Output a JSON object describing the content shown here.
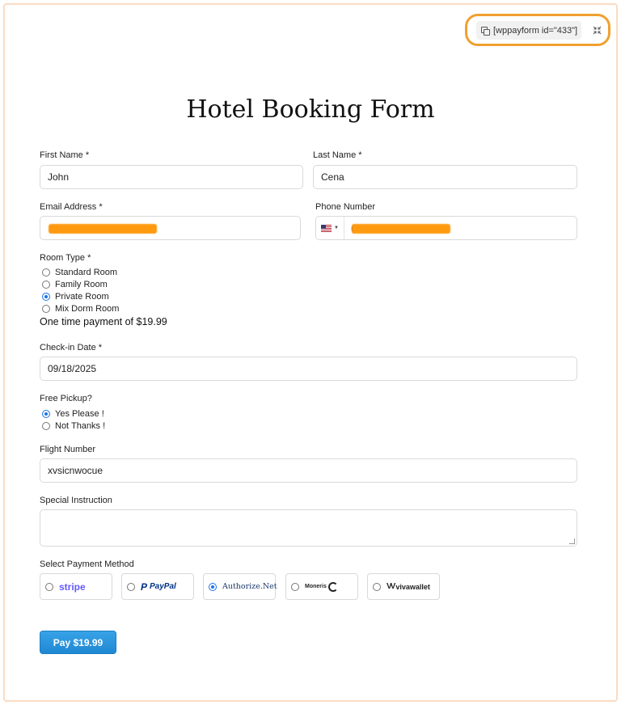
{
  "shortcode": {
    "text": "[wppayform id=\"433\"]"
  },
  "form": {
    "title": "Hotel Booking Form",
    "first_name": {
      "label": "First Name *",
      "value": "John"
    },
    "last_name": {
      "label": "Last Name *",
      "value": "Cena"
    },
    "email": {
      "label": "Email Address *"
    },
    "phone": {
      "label": "Phone Number",
      "prefix": "("
    },
    "room_type": {
      "label": "Room Type *",
      "options": [
        "Standard Room",
        "Family Room",
        "Private Room",
        "Mix Dorm Room"
      ],
      "selected": "Private Room"
    },
    "payment_note": "One time payment of $19.99",
    "checkin": {
      "label": "Check-in Date *",
      "value": "09/18/2025"
    },
    "pickup": {
      "label": "Free Pickup?",
      "options": [
        "Yes Please !",
        "Not Thanks !"
      ],
      "selected": "Yes Please !"
    },
    "flight": {
      "label": "Flight Number",
      "value": "xvsicnwocue"
    },
    "special": {
      "label": "Special Instruction",
      "value": ""
    },
    "payment_method": {
      "label": "Select Payment Method",
      "options": [
        "stripe",
        "PayPal",
        "Authorize.Net",
        "Moneris",
        "vivawallet"
      ],
      "selected": "Authorize.Net"
    },
    "pay_button": "Pay $19.99"
  },
  "colors": {
    "accent": "#1a73e8",
    "highlight": "#f0a030",
    "redaction": "#ff9a10",
    "button": "#2a95dc"
  }
}
